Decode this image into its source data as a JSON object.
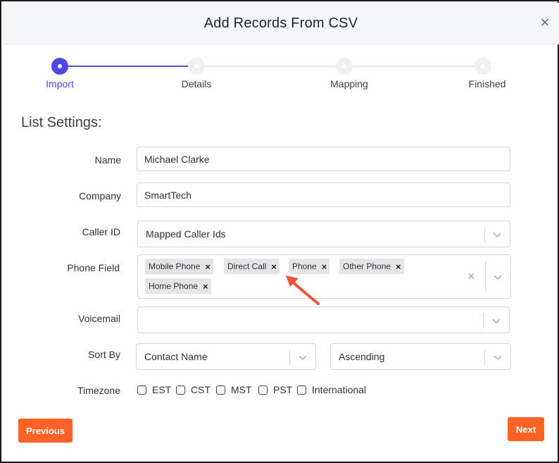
{
  "dialog": {
    "title": "Add Records From CSV",
    "close_glyph": "×"
  },
  "stepper": {
    "steps": [
      {
        "label": "Import",
        "state": "active"
      },
      {
        "label": "Details",
        "state": "pending"
      },
      {
        "label": "Mapping",
        "state": "pending"
      },
      {
        "label": "Finished",
        "state": "pending"
      }
    ]
  },
  "section": {
    "title": "List Settings:"
  },
  "form": {
    "name": {
      "label": "Name",
      "value": "Michael Clarke"
    },
    "company": {
      "label": "Company",
      "value": "SmartTech"
    },
    "caller_id": {
      "label": "Caller ID",
      "value": "Mapped Caller Ids"
    },
    "phone_field": {
      "label": "Phone Field",
      "chips": [
        "Mobile Phone",
        "Direct Call",
        "Phone",
        "Other Phone",
        "Home Phone"
      ],
      "chip_remove_glyph": "×",
      "clear_glyph": "×"
    },
    "voicemail": {
      "label": "Voicemail",
      "value": ""
    },
    "sort_by": {
      "label": "Sort By",
      "field_value": "Contact Name",
      "order_value": "Ascending"
    },
    "timezone": {
      "label": "Timezone",
      "options": [
        "EST",
        "CST",
        "MST",
        "PST",
        "International"
      ]
    }
  },
  "buttons": {
    "previous": "Previous",
    "next": "Next"
  },
  "colors": {
    "accent": "#5048e5",
    "button": "#ff6224",
    "annotation_arrow": "#f0553a"
  }
}
